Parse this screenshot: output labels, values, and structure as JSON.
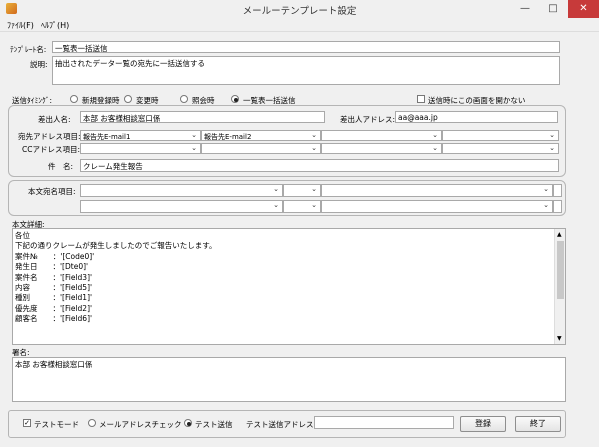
{
  "window": {
    "title": "メールーテンプレート設定",
    "minimize_glyph": "—",
    "maximize_glyph": "□",
    "close_glyph": "✕"
  },
  "menu": {
    "file": "ﾌｧｲﾙ(F)",
    "help": "ﾍﾙﾌﾟ(H)"
  },
  "template_name": {
    "label": "ﾃﾝﾌﾟﾚｰﾄ名:",
    "value": "一覧表一括送信"
  },
  "description": {
    "label": "説明:",
    "value": "抽出されたデーター覧の宛先に一括送信する"
  },
  "send_timing": {
    "label": "送信ﾀｲﾐﾝｸﾞ:",
    "options": [
      "新規登録時",
      "変更時",
      "照会時",
      "一覧表一括送信"
    ],
    "selected_index": 3,
    "no_screen_label": "送信時にこの画面を開かない",
    "no_screen_checked": false
  },
  "sender": {
    "name_label": "差出人名:",
    "name_value": "本部 お客様相談窓口係",
    "address_label": "差出人アドレス:",
    "address_value": "aa@aaa.jp"
  },
  "to_address": {
    "label": "宛先アドレス項目:",
    "combos": [
      "報告先E-mail1",
      "報告先E-mail2",
      "",
      ""
    ]
  },
  "cc_address": {
    "label": "CCアドレス項目:",
    "combos": [
      "",
      "",
      "",
      ""
    ]
  },
  "subject": {
    "label": "件　名:",
    "value": "クレーム発生報告"
  },
  "body_recipient": {
    "label": "本文宛名項目:",
    "row1": [
      "",
      "",
      "",
      ""
    ],
    "row2": [
      "",
      "",
      "",
      ""
    ]
  },
  "body_detail": {
    "label": "本文詳細:",
    "lines": [
      "各位",
      "",
      "下記の通りクレームが発生しましたのでご報告いたします。",
      "",
      "案件№　　：'[Code0]'",
      "発生日　　：'[Dte0]'",
      "案件名　　：'[Field3]'",
      "内容　　　：'[Field5]'",
      "種別　　　：'[Field1]'",
      "優先度　　：'[Field2]'",
      "顧客名　　：'[Field6]'"
    ]
  },
  "signature": {
    "label": "署名:",
    "value": "本部 お客様相談窓口係"
  },
  "footer": {
    "test_mode_label": "テストモード",
    "test_mode_checked": true,
    "mode_options": [
      "メールアドレスチェック",
      "テスト送信"
    ],
    "mode_selected_index": 1,
    "test_address_label": "テスト送信アドレス:",
    "test_address_value": "",
    "register_label": "登録",
    "close_label": "終了"
  }
}
